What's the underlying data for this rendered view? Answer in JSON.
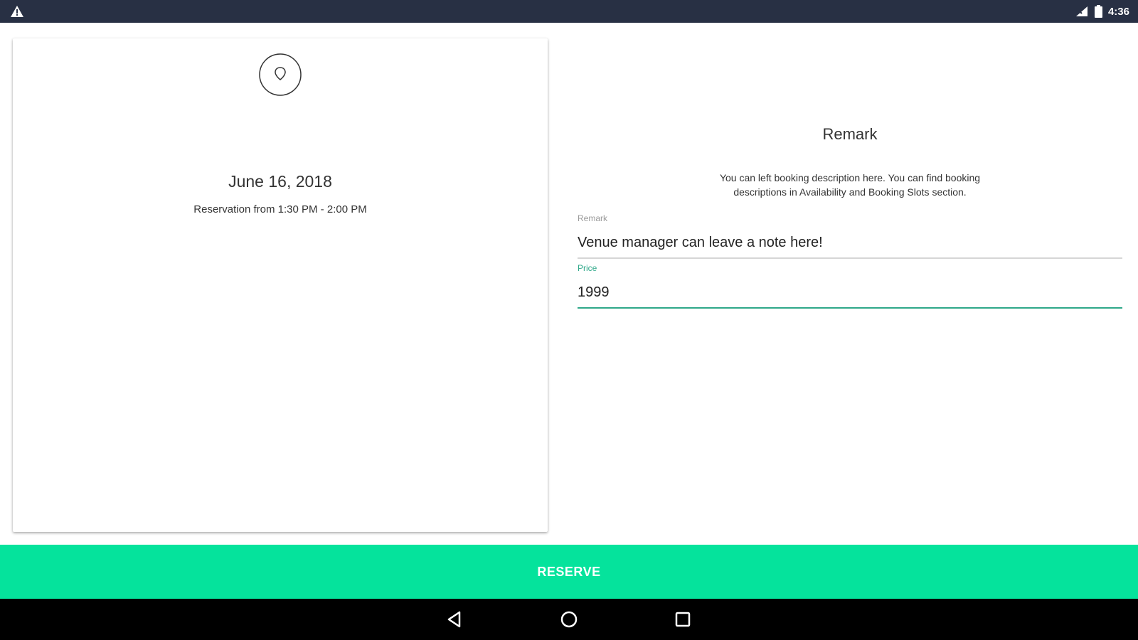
{
  "status_bar": {
    "left_icon": "warning-icon",
    "time": "4:36",
    "icons": [
      "signal-icon",
      "battery-icon"
    ]
  },
  "booking_card": {
    "logo_icon": "location-pin-icon",
    "date": "June 16, 2018",
    "time_range": "Reservation from 1:30 PM - 2:00 PM"
  },
  "remark_panel": {
    "title": "Remark",
    "description": "You can left booking description here. You can find booking descriptions in Availability and Booking Slots section.",
    "remark_field": {
      "label": "Remark",
      "value": "Venue manager can leave a note here!"
    },
    "price_field": {
      "label": "Price",
      "value": "1999"
    }
  },
  "reserve_button": {
    "label": "RESERVE"
  },
  "nav_bar": {
    "icons": [
      "back-icon",
      "home-icon",
      "recents-icon"
    ]
  },
  "colors": {
    "status_bar": "#283044",
    "accent": "#05e39c",
    "focus_underline": "#2ea889",
    "nav_bar": "#000000"
  }
}
